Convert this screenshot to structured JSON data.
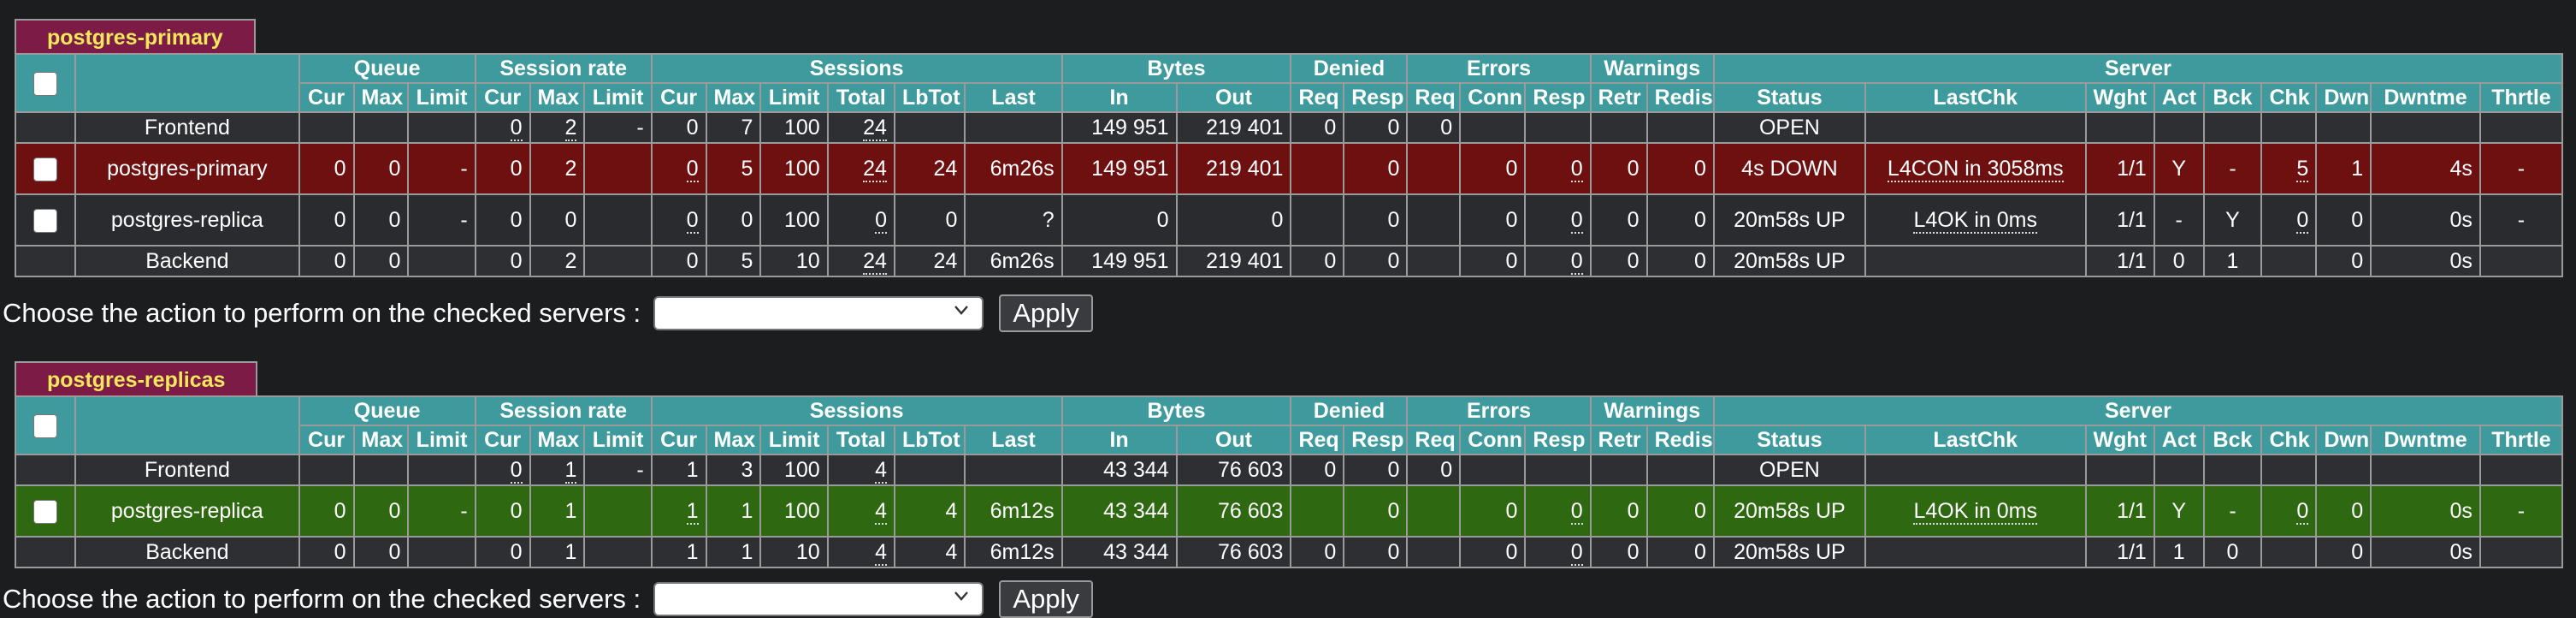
{
  "action_label": "Choose the action to perform on the checked servers :",
  "apply_label": "Apply",
  "header": {
    "groups": [
      "Queue",
      "Session rate",
      "Sessions",
      "Bytes",
      "Denied",
      "Errors",
      "Warnings",
      "Server"
    ],
    "columns": [
      "Cur",
      "Max",
      "Limit",
      "Cur",
      "Max",
      "Limit",
      "Cur",
      "Max",
      "Limit",
      "Total",
      "LbTot",
      "Last",
      "In",
      "Out",
      "Req",
      "Resp",
      "Req",
      "Conn",
      "Resp",
      "Retr",
      "Redis",
      "Status",
      "LastChk",
      "Wght",
      "Act",
      "Bck",
      "Chk",
      "Dwn",
      "Dwntme",
      "Thrtle"
    ]
  },
  "proxies": [
    {
      "name": "postgres-primary",
      "frontend": {
        "name": "Frontend",
        "cells": [
          "",
          "",
          "",
          "0",
          "2",
          "-",
          "0",
          "7",
          "100",
          "24",
          "",
          "",
          "149 951",
          "219 401",
          "0",
          "0",
          "0",
          "",
          "",
          "",
          "",
          "OPEN",
          "",
          "",
          "",
          "",
          "",
          "",
          "",
          ""
        ]
      },
      "servers": [
        {
          "name": "postgres-primary",
          "cells": [
            "0",
            "0",
            "-",
            "0",
            "2",
            "",
            "0",
            "5",
            "100",
            "24",
            "24",
            "6m26s",
            "149 951",
            "219 401",
            "",
            "0",
            "",
            "0",
            "0",
            "0",
            "0",
            "4s DOWN",
            "L4CON in 3058ms",
            "1/1",
            "Y",
            "-",
            "5",
            "1",
            "4s",
            "-"
          ]
        },
        {
          "name": "postgres-replica",
          "cells": [
            "0",
            "0",
            "-",
            "0",
            "0",
            "",
            "0",
            "0",
            "100",
            "0",
            "0",
            "?",
            "0",
            "0",
            "",
            "0",
            "",
            "0",
            "0",
            "0",
            "0",
            "20m58s UP",
            "L4OK in 0ms",
            "1/1",
            "-",
            "Y",
            "0",
            "0",
            "0s",
            "-"
          ]
        }
      ],
      "backend": {
        "name": "Backend",
        "cells": [
          "0",
          "0",
          "",
          "0",
          "2",
          "",
          "0",
          "5",
          "10",
          "24",
          "24",
          "6m26s",
          "149 951",
          "219 401",
          "0",
          "0",
          "",
          "0",
          "0",
          "0",
          "0",
          "20m58s UP",
          "",
          "1/1",
          "0",
          "1",
          "",
          "0",
          "0s",
          ""
        ]
      }
    },
    {
      "name": "postgres-replicas",
      "frontend": {
        "name": "Frontend",
        "cells": [
          "",
          "",
          "",
          "0",
          "1",
          "-",
          "1",
          "3",
          "100",
          "4",
          "",
          "",
          "43 344",
          "76 603",
          "0",
          "0",
          "0",
          "",
          "",
          "",
          "",
          "OPEN",
          "",
          "",
          "",
          "",
          "",
          "",
          "",
          ""
        ]
      },
      "servers": [
        {
          "name": "postgres-replica",
          "cells": [
            "0",
            "0",
            "-",
            "0",
            "1",
            "",
            "1",
            "1",
            "100",
            "4",
            "4",
            "6m12s",
            "43 344",
            "76 603",
            "",
            "0",
            "",
            "0",
            "0",
            "0",
            "0",
            "20m58s UP",
            "L4OK in 0ms",
            "1/1",
            "Y",
            "-",
            "0",
            "0",
            "0s",
            "-"
          ]
        }
      ],
      "backend": {
        "name": "Backend",
        "cells": [
          "0",
          "0",
          "",
          "0",
          "1",
          "",
          "1",
          "1",
          "10",
          "4",
          "4",
          "6m12s",
          "43 344",
          "76 603",
          "0",
          "0",
          "",
          "0",
          "0",
          "0",
          "0",
          "20m58s UP",
          "",
          "1/1",
          "1",
          "0",
          "",
          "0",
          "0s",
          ""
        ]
      }
    }
  ],
  "colors": {
    "header_teal": "#3e9a9c",
    "proxy_tab": "#7c1c46",
    "proxy_tab_text": "#f3e85c",
    "server_down": "#6e1010",
    "server_up_green": "#2e6810",
    "row_dark": "#2e2f33"
  }
}
